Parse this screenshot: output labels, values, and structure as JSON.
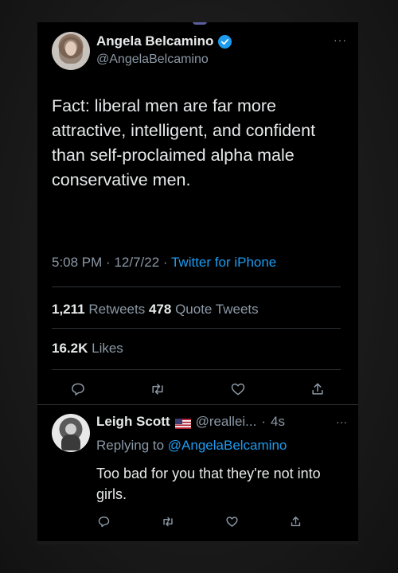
{
  "tweet": {
    "author": {
      "display_name": "Angela Belcamino",
      "handle": "@AngelaBelcamino"
    },
    "text": "Fact: liberal men are far more attractive, intelligent, and confident than self-proclaimed alpha male conservative men.",
    "time": "5:08 PM",
    "date": "12/7/22",
    "source": "Twitter for iPhone",
    "retweets_count": "1,211",
    "retweets_label": "Retweets",
    "quotes_count": "478",
    "quotes_label": "Quote Tweets",
    "likes_count": "16.2K",
    "likes_label": "Likes"
  },
  "reply": {
    "display_name": "Leigh Scott",
    "handle": "@reallei...",
    "time": "4s",
    "replying_prefix": "Replying to",
    "replying_to": "@AngelaBelcamino",
    "text": "Too bad for you that they're not into girls."
  },
  "colors": {
    "background": "#000000",
    "text": "#e7e9ea",
    "muted": "#8b98a5",
    "accent": "#1d9bf0",
    "divider": "#2f3336"
  },
  "icons": {
    "verified": "verified-badge-icon",
    "more": "more-icon",
    "reply": "reply-icon",
    "retweet": "retweet-icon",
    "like": "heart-icon",
    "share": "share-icon",
    "flag": "us-flag-icon"
  }
}
